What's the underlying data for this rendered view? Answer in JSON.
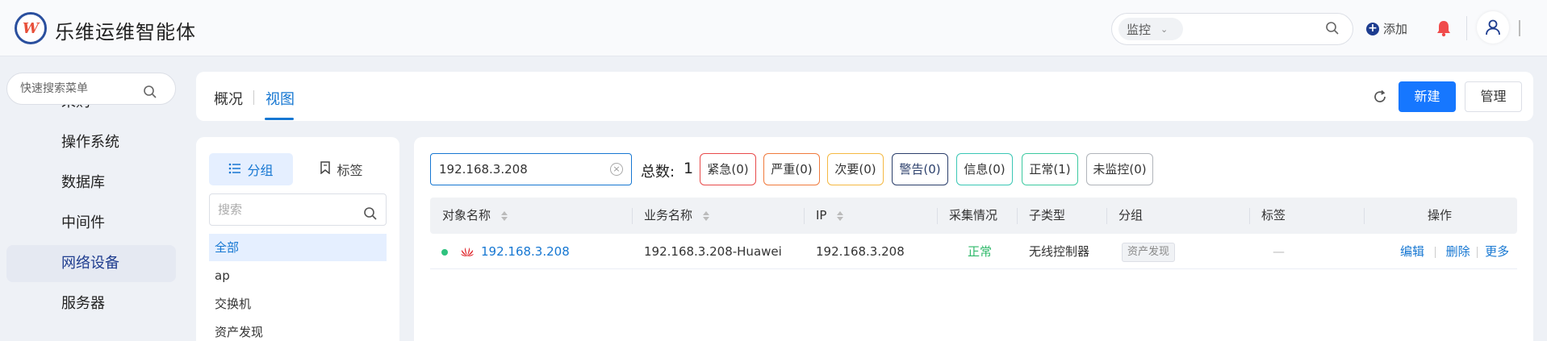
{
  "header": {
    "app_title": "乐维运维智能体",
    "search_select": "监控",
    "add_label": "添加",
    "colors": {
      "brand": "#1d3c8f",
      "alert": "#f04b4b"
    }
  },
  "sidebar": {
    "search_placeholder": "快速搜索菜单",
    "items": [
      {
        "label": "采购"
      },
      {
        "label": "操作系统"
      },
      {
        "label": "数据库"
      },
      {
        "label": "中间件"
      },
      {
        "label": "网络设备"
      },
      {
        "label": "服务器"
      }
    ],
    "active_index": 4
  },
  "tabs": {
    "overview": "概况",
    "view": "视图",
    "active": "视图",
    "new_button": "新建",
    "manage_button": "管理"
  },
  "group_panel": {
    "tab_group": "分组",
    "tab_tag": "标签",
    "search_placeholder": "搜索",
    "items": [
      {
        "label": "全部"
      },
      {
        "label": "ap"
      },
      {
        "label": "交换机"
      },
      {
        "label": "资产发现"
      }
    ]
  },
  "filters": {
    "search_value": "192.168.3.208",
    "total_label": "总数:",
    "total_count": "1",
    "severity": [
      {
        "label": "紧急(0)",
        "color": "#e84a4a"
      },
      {
        "label": "严重(0)",
        "color": "#f07a3c"
      },
      {
        "label": "次要(0)",
        "color": "#f5b942"
      },
      {
        "label": "警告(0)",
        "color": "#2b3f6b"
      },
      {
        "label": "信息(0)",
        "color": "#3ac7b5"
      },
      {
        "label": "正常(1)",
        "color": "#3cc9a0"
      },
      {
        "label": "未监控(0)",
        "color": "#b0b4ba"
      }
    ]
  },
  "table": {
    "columns": [
      "对象名称",
      "业务名称",
      "IP",
      "采集情况",
      "子类型",
      "分组",
      "标签",
      "操作"
    ],
    "rows": [
      {
        "name": "192.168.3.208",
        "business_name": "192.168.3.208-Huawei",
        "ip": "192.168.3.208",
        "collect_status": "正常",
        "subtype": "无线控制器",
        "group": "资产发现",
        "tag": "—",
        "ops": {
          "edit": "编辑",
          "delete": "删除",
          "more": "更多"
        }
      }
    ]
  }
}
